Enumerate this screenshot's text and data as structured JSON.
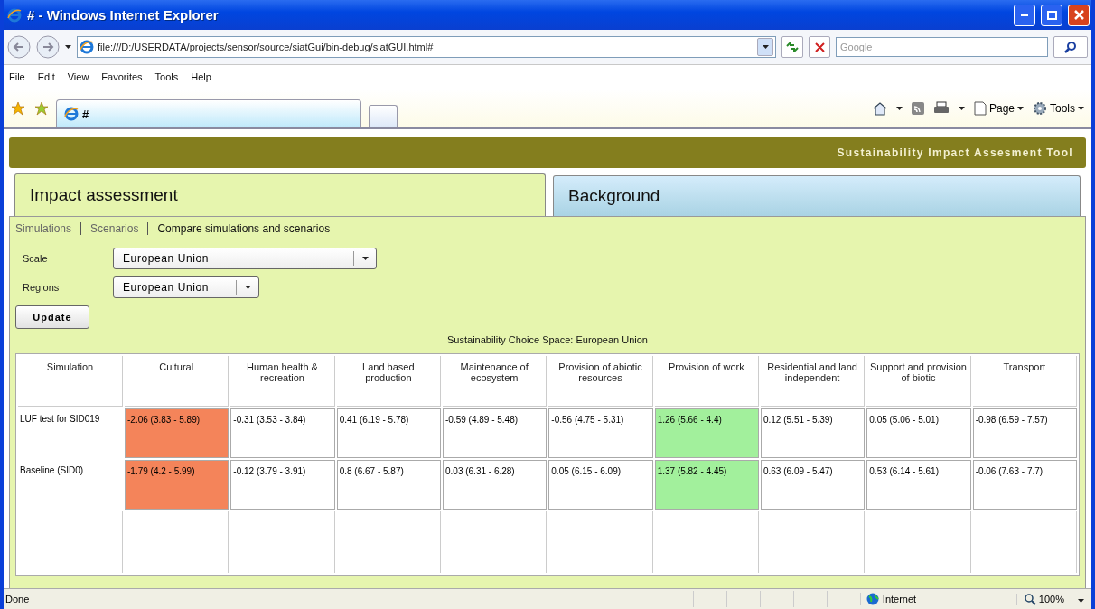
{
  "window": {
    "title": "# - Windows Internet Explorer"
  },
  "address_bar": {
    "url": "file:///D:/USERDATA/projects/sensor/source/siatGui/bin-debug/siatGUI.html#",
    "search_placeholder": "Google"
  },
  "menu": [
    "File",
    "Edit",
    "View",
    "Favorites",
    "Tools",
    "Help"
  ],
  "browser_tab": {
    "title": "#"
  },
  "command_bar": [
    "Page",
    "Tools"
  ],
  "app": {
    "header_title": "Sustainability Impact Assesment Tool",
    "tabs": [
      {
        "label": "Impact assessment",
        "selected": true
      },
      {
        "label": "Background",
        "selected": false
      }
    ],
    "subnav": [
      {
        "label": "Simulations",
        "selected": false
      },
      {
        "label": "Scenarios",
        "selected": false
      },
      {
        "label": "Compare simulations and scenarios",
        "selected": true
      }
    ],
    "filters": [
      {
        "label": "Scale",
        "value": "European Union",
        "wide": true
      },
      {
        "label": "Regions",
        "value": "European Union",
        "wide": false
      }
    ],
    "update_button": "Update",
    "table": {
      "title": "Sustainability Choice Space: European Union",
      "columns": [
        "Simulation",
        "Cultural",
        "Human health & recreation",
        "Land based production",
        "Maintenance of ecosystem",
        "Provision of abiotic resources",
        "Provision of work",
        "Residential and land independent",
        "Support and provision of biotic",
        "Transport"
      ],
      "rows": [
        {
          "cells": [
            {
              "text": "LUF test for SID019"
            },
            {
              "text": "-2.06 (3.83 - 5.89)",
              "color": "#f4845a"
            },
            {
              "text": "-0.31 (3.53 - 3.84)"
            },
            {
              "text": "0.41 (6.19 - 5.78)"
            },
            {
              "text": "-0.59 (4.89 - 5.48)"
            },
            {
              "text": "-0.56 (4.75 - 5.31)"
            },
            {
              "text": "1.26 (5.66 - 4.4)",
              "color": "#a2f09c"
            },
            {
              "text": "0.12 (5.51 - 5.39)"
            },
            {
              "text": "0.05 (5.06 - 5.01)"
            },
            {
              "text": "-0.98 (6.59 - 7.57)"
            }
          ]
        },
        {
          "cells": [
            {
              "text": "Baseline (SID0)"
            },
            {
              "text": "-1.79 (4.2 - 5.99)",
              "color": "#f4845a"
            },
            {
              "text": "-0.12 (3.79 - 3.91)"
            },
            {
              "text": "0.8 (6.67 - 5.87)"
            },
            {
              "text": "0.03 (6.31 - 6.28)"
            },
            {
              "text": "0.05 (6.15 - 6.09)"
            },
            {
              "text": "1.37 (5.82 - 4.45)",
              "color": "#a2f09c"
            },
            {
              "text": "0.63 (6.09 - 5.47)"
            },
            {
              "text": "0.53 (6.14 - 5.61)"
            },
            {
              "text": "-0.06 (7.63 - 7.7)"
            }
          ]
        }
      ]
    }
  },
  "status_bar": {
    "text": "Done",
    "zone": "Internet",
    "zoom": "100%"
  }
}
